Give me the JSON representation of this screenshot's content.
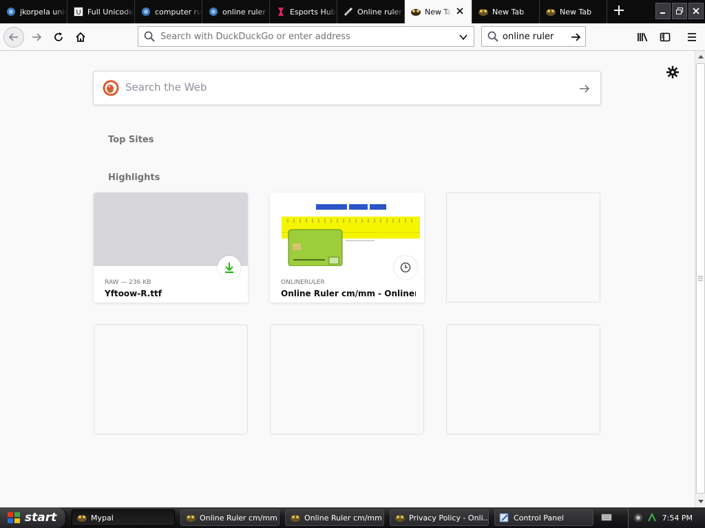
{
  "tabs": [
    {
      "title": "jkorpela unicode",
      "icon": "duckduckgo-icon",
      "active": false
    },
    {
      "title": "Full Unicode",
      "icon": "unicode-icon",
      "active": false
    },
    {
      "title": "computer ruler",
      "icon": "duckduckgo-icon",
      "active": false
    },
    {
      "title": "online ruler",
      "icon": "duckduckgo-icon",
      "active": false
    },
    {
      "title": "Esports Hub",
      "icon": "esports-icon",
      "active": false
    },
    {
      "title": "Online ruler",
      "icon": "ruler-icon",
      "active": false
    },
    {
      "title": "New Tab",
      "icon": "pal-icon",
      "active": true
    },
    {
      "title": "New Tab",
      "icon": "pal-icon",
      "active": false
    },
    {
      "title": "New Tab",
      "icon": "pal-icon",
      "active": false
    }
  ],
  "urlbar": {
    "placeholder": "Search with DuckDuckGo or enter address"
  },
  "searchbar": {
    "value": "online ruler"
  },
  "newtab": {
    "search_placeholder": "Search the Web",
    "top_sites_title": "Top Sites",
    "highlights_title": "Highlights",
    "highlights": [
      {
        "meta": "RAW — 236 KB",
        "title": "Yftoow-R.ttf",
        "badge": "download-icon"
      },
      {
        "meta": "ONLINERULER",
        "title": "Online Ruler cm/mm - Onlinerul...",
        "badge": "history-icon"
      }
    ]
  },
  "taskbar": {
    "start_label": "start",
    "tasks": [
      {
        "label": "Mypal",
        "active": true
      },
      {
        "label": "Online Ruler cm/mm ...",
        "active": false
      },
      {
        "label": "Online Ruler cm/mm ...",
        "active": false
      },
      {
        "label": "Privacy Policy - Onli...",
        "active": false
      },
      {
        "label": "Control Panel",
        "active": false
      }
    ],
    "clock": "7:54 PM"
  },
  "colors": {
    "accent_download": "#12bc00",
    "ruler_yellow": "#f5f500",
    "card_green": "#9ccd3a"
  }
}
